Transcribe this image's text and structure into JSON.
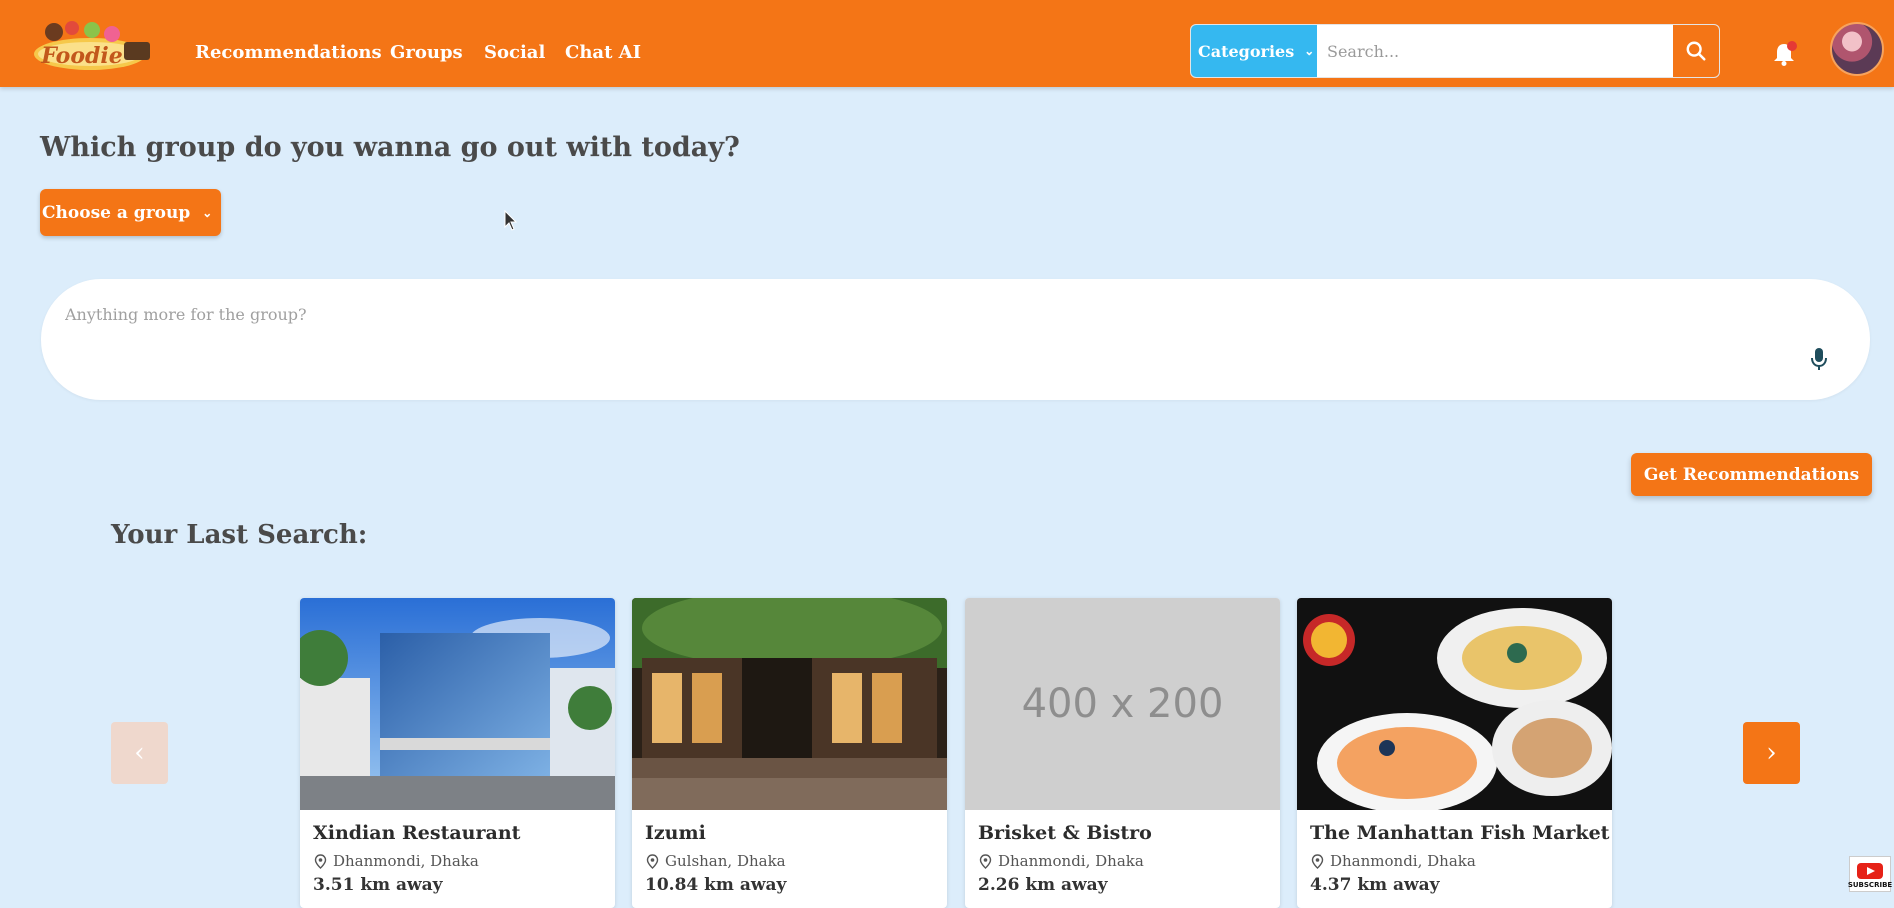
{
  "nav": {
    "brand": "Foodie",
    "links": [
      "Recommendations",
      "Groups",
      "Social",
      "Chat AI"
    ],
    "categories_label": "Categories",
    "search_placeholder": "Search..."
  },
  "main": {
    "heading": "Which group do you wanna go out with today?",
    "choose_group_label": "Choose a group",
    "prompt_placeholder": "Anything more for the group?",
    "get_recommendations_label": "Get Recommendations",
    "last_search_heading": "Your Last Search:"
  },
  "cards": [
    {
      "name": "Xindian Restaurant",
      "location": "Dhanmondi, Dhaka",
      "distance": "3.51 km away",
      "image": "building-photo"
    },
    {
      "name": "Izumi",
      "location": "Gulshan, Dhaka",
      "distance": "10.84 km away",
      "image": "courtyard-photo"
    },
    {
      "name": "Brisket & Bistro",
      "location": "Dhanmondi, Dhaka",
      "distance": "2.26 km away",
      "image": "placeholder",
      "placeholder_text": "400 x 200"
    },
    {
      "name": "The Manhattan Fish Market",
      "location": "Dhanmondi, Dhaka",
      "distance": "4.37 km away",
      "image": "seafood-photo"
    }
  ],
  "badge": {
    "subscribe": "SUBSCRIBE"
  },
  "colors": {
    "brand_orange": "#f47516",
    "category_blue": "#35b8f0",
    "page_bg": "#dcedfb"
  }
}
